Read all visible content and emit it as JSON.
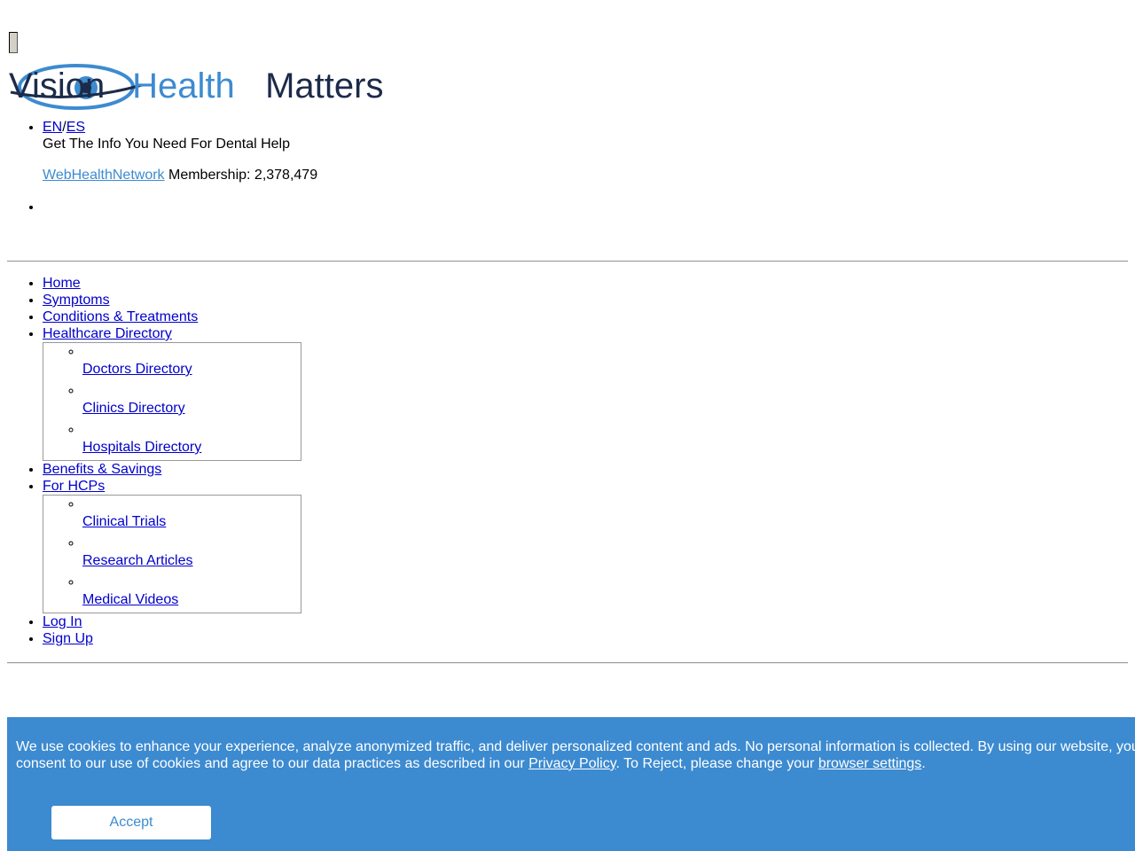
{
  "header": {
    "logo_text_part1": "Vision",
    "logo_text_part2": " Health",
    "logo_text_part3": " Matters",
    "lang_en": "EN",
    "lang_sep": "/",
    "lang_es": "ES",
    "tagline": "Get The Info You Need For Dental Help",
    "network_link": "WebHealthNetwork",
    "membership_label": " Membership: 2,378,479"
  },
  "nav": {
    "home": "Home",
    "symptoms": "Symptoms",
    "conditions": "Conditions & Treatments",
    "healthcare_directory": "Healthcare Directory",
    "directory_items": [
      "Doctors Directory",
      "Clinics Directory",
      "Hospitals Directory"
    ],
    "benefits": "Benefits & Savings",
    "for_hcps": "For HCPs",
    "hcp_items": [
      "Clinical Trials",
      "Research Articles",
      "Medical Videos"
    ],
    "log_in": "Log In",
    "sign_up": "Sign Up"
  },
  "cookie": {
    "text_before": "We use cookies to enhance your experience, analyze anonymized traffic, and deliver personalized content and ads. No personal information is collected. By using our website, you consent to our use of cookies and agree to our data practices as described in our ",
    "privacy_link": "Privacy Policy",
    "text_middle": ". To Reject, please change your ",
    "settings_link": "browser settings",
    "text_end": ".",
    "accept_label": "Accept"
  },
  "colors": {
    "banner_bg": "#3c8ad0",
    "logo_blue": "#3d8bd0",
    "logo_navy": "#1c2b4a",
    "link": "#0000cc"
  }
}
